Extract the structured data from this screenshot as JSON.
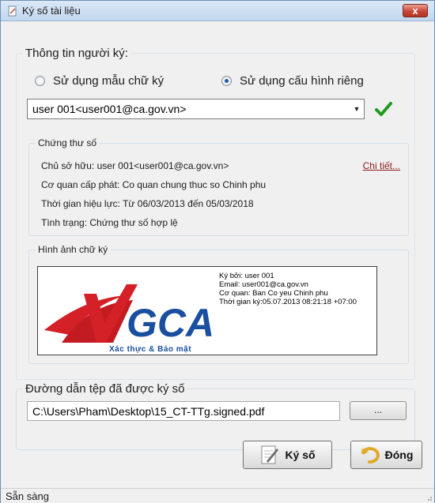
{
  "window": {
    "title": "Ký số tài liệu",
    "close_label": "x"
  },
  "signer": {
    "legend": "Thông tin người ký:",
    "radio_template": "Sử dụng mẫu chữ ký",
    "radio_custom": "Sử dụng cấu hình riêng",
    "selected_radio": "custom",
    "selected_user": "user 001<user001@ca.gov.vn>",
    "status_icon": "green-checkmark-icon"
  },
  "certificate": {
    "legend": "Chứng thư số",
    "owner": "Chủ sở hữu: user 001<user001@ca.gov.vn>",
    "detail_link": "Chi tiết...",
    "issuer": "Cơ quan cấp phát: Co quan chung thuc so Chinh phu",
    "validity": "Thời gian hiệu lực: Từ 06/03/2013 đến 05/03/2018",
    "status": "Tình trạng: Chứng thư số hợp lệ"
  },
  "signature_image": {
    "legend": "Hình ảnh chữ ký",
    "logo_text": "GCA",
    "logo_tagline": "Xác thực & Bảo mật",
    "signed_by": "Ký bởi: user 001",
    "email": "Email: user001@ca.gov.vn",
    "agency": "Cơ quan: Ban Co yeu Chinh phu",
    "sign_time": "Thời gian ký:05.07.2013 08:21:18 +07:00"
  },
  "output": {
    "legend": "Đường dẫn tệp đã được ký số",
    "path_value": "C:\\Users\\Pham\\Desktop\\15_CT-TTg.signed.pdf",
    "browse_label": "..."
  },
  "buttons": {
    "sign_label": "Ký số",
    "close_label": "Đóng"
  },
  "status_bar": {
    "text": "Sẵn sàng"
  },
  "colors": {
    "accent_check": "#1e9a1e",
    "link": "#8b1a1a",
    "logo_red": "#d42027",
    "logo_blue": "#1a4fa0"
  }
}
